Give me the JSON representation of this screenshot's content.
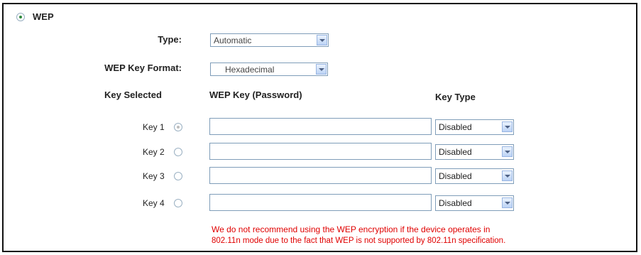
{
  "wep": {
    "title": "WEP",
    "type_label": "Type:",
    "type_value": "Automatic",
    "format_label": "WEP Key Format:",
    "format_value": "Hexadecimal",
    "col_key_selected": "Key Selected",
    "col_wep_key": "WEP Key (Password)",
    "col_key_type": "Key Type",
    "keys": [
      {
        "label": "Key 1",
        "value": "",
        "type": "Disabled",
        "selected": true
      },
      {
        "label": "Key 2",
        "value": "",
        "type": "Disabled",
        "selected": false
      },
      {
        "label": "Key 3",
        "value": "",
        "type": "Disabled",
        "selected": false
      },
      {
        "label": "Key 4",
        "value": "",
        "type": "Disabled",
        "selected": false
      }
    ],
    "note_line1": "We do not recommend using the WEP encryption if the device operates in",
    "note_line2": "802.11n mode due to the fact that WEP is not supported by 802.11n specification."
  },
  "colors": {
    "radio_checked": "#2f8a3d",
    "note": "#e00000",
    "border": "#7f9db9"
  }
}
